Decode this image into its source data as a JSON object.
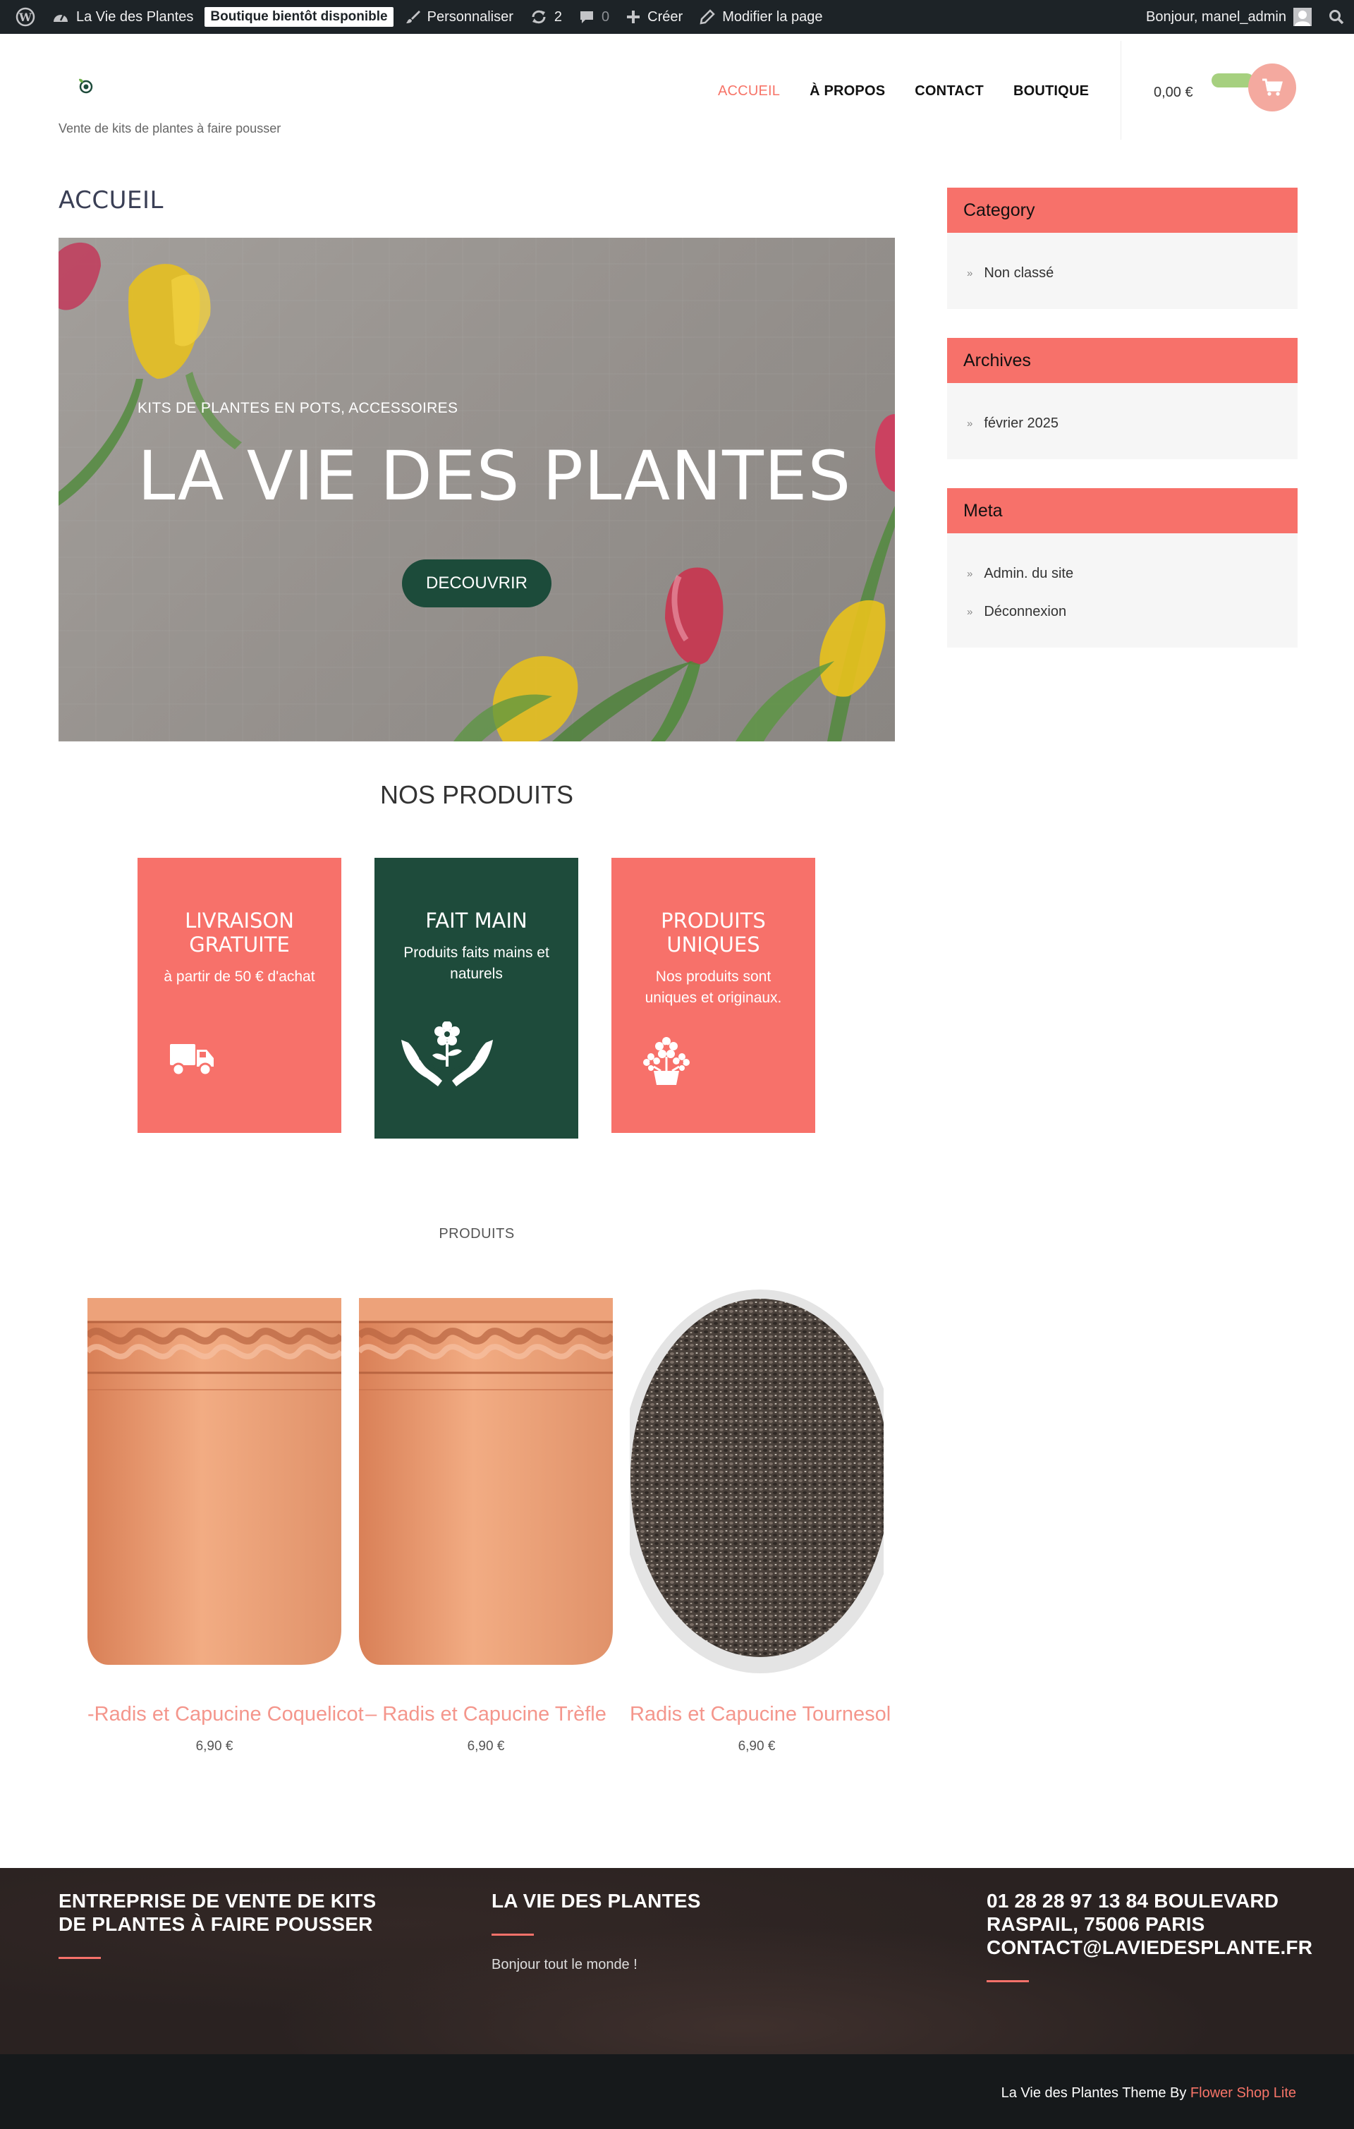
{
  "adminbar": {
    "site_name": "La Vie des Plantes",
    "store_badge": "Boutique bientôt disponible",
    "customize": "Personnaliser",
    "updates_count": "2",
    "comments_count": "0",
    "new": "Créer",
    "edit_page": "Modifier la page",
    "greeting": "Bonjour, manel_admin"
  },
  "header": {
    "tagline": "Vente de kits de plantes à faire pousser",
    "nav": [
      "ACCUEIL",
      "À PROPOS",
      "CONTACT",
      "BOUTIQUE"
    ],
    "cart_amount": "0,00 €"
  },
  "main": {
    "page_title": "ACCUEIL",
    "hero": {
      "subtitle": "KITS DE PLANTES EN POTS, ACCESSOIRES",
      "title": "LA VIE DES PLANTES",
      "button": "DECOUVRIR"
    },
    "section_title": "NOS PRODUITS",
    "features": [
      {
        "title": "LIVRAISON GRATUITE",
        "text": "à partir de 50 € d'achat",
        "icon": "truck-icon"
      },
      {
        "title": "FAIT MAIN",
        "text": "Produits faits mains et naturels",
        "icon": "hands-flower-icon"
      },
      {
        "title": "PRODUITS UNIQUES",
        "text": "Nos produits sont uniques et originaux.",
        "icon": "flower-pot-icon"
      }
    ],
    "products_label": "PRODUITS",
    "products": [
      {
        "name": "-Radis et Capucine Coquelicot",
        "price": "6,90 €",
        "image": "terracotta-pot"
      },
      {
        "name": "– Radis et Capucine Trèfle",
        "price": "6,90 €",
        "image": "terracotta-pot"
      },
      {
        "name": "Radis et Capucine Tournesol",
        "price": "6,90 €",
        "image": "seed-bowl"
      }
    ]
  },
  "sidebar": {
    "category": {
      "title": "Category",
      "items": [
        "Non classé"
      ]
    },
    "archives": {
      "title": "Archives",
      "items": [
        "février 2025"
      ]
    },
    "meta": {
      "title": "Meta",
      "items": [
        "Admin. du site",
        "Déconnexion"
      ]
    }
  },
  "footer": {
    "col1_title": "ENTREPRISE DE VENTE DE KITS DE PLANTES À FAIRE POUSSER",
    "col2_title": "LA VIE DES PLANTES",
    "col2_text": "Bonjour tout le monde !",
    "col3_title": "01 28 28 97 13 84 BOULEVARD RASPAIL, 75006 PARIS CONTACT@LAVIEDESPLANTE.FR",
    "copyright_text": "La Vie des Plantes Theme By",
    "copyright_link": "Flower Shop Lite"
  },
  "colors": {
    "accent": "#f7716a",
    "dark_green": "#1e4b3b",
    "admin_bar": "#1d2327",
    "footer": "#2a2221"
  }
}
